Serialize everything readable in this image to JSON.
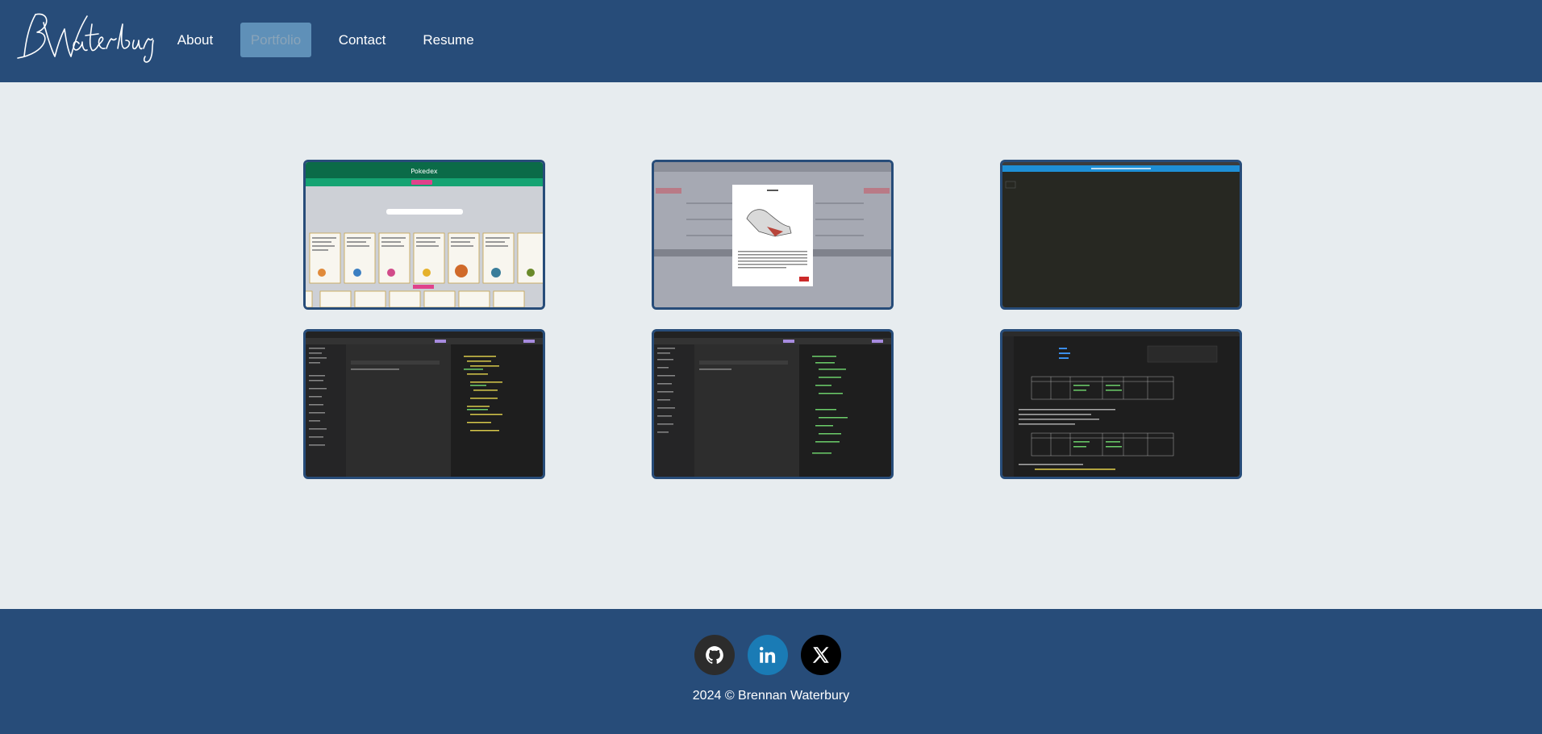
{
  "header": {
    "logo_alt": "BWaterbury",
    "nav": [
      {
        "label": "About"
      },
      {
        "label": "Portfolio"
      },
      {
        "label": "Contact"
      },
      {
        "label": "Resume"
      }
    ]
  },
  "portfolio": {
    "projects": [
      {
        "screenshot_title": "Pokedex"
      },
      {
        "screenshot_title": ""
      },
      {
        "screenshot_title": ""
      },
      {
        "screenshot_title": ""
      },
      {
        "screenshot_title": ""
      },
      {
        "screenshot_title": ""
      }
    ]
  },
  "footer": {
    "social": [
      {
        "icon": "github-icon"
      },
      {
        "icon": "linkedin-icon"
      },
      {
        "icon": "x-icon"
      }
    ],
    "copyright": "2024 © Brennan Waterbury"
  },
  "colors": {
    "header_bg": "#274c79",
    "page_bg": "#e7ecef",
    "active_nav_bg": "#5f90b8",
    "linkedin": "#1a7bb5"
  }
}
